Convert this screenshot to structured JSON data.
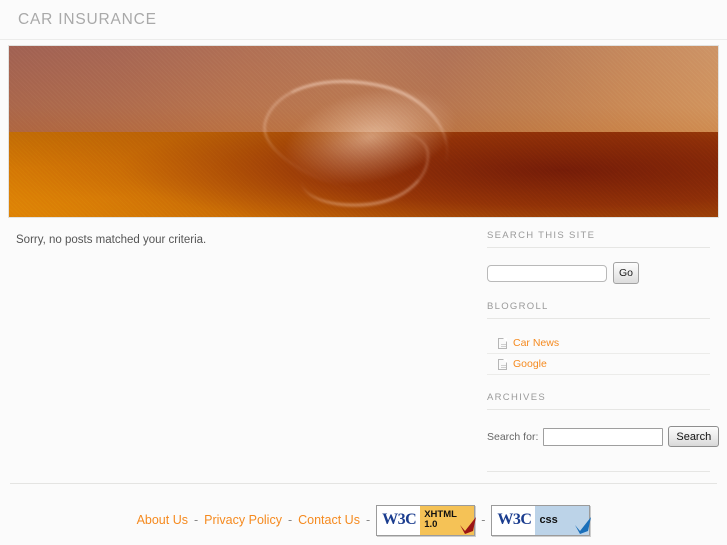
{
  "header": {
    "site_title": "CAR INSURANCE"
  },
  "banner": {
    "alt": "abstract orange gradient header image",
    "colors": {
      "top_left": "#a9695c",
      "top_right": "#e2aa77",
      "bottom_left": "#e58a06",
      "bottom_right": "#8d2c06",
      "swoosh": "#ffe4cd"
    }
  },
  "content": {
    "no_posts_message": "Sorry, no posts matched your criteria."
  },
  "sidebar": {
    "widgets": [
      {
        "id": "search-this-site",
        "title": "SEARCH THIS SITE",
        "input_value": "",
        "input_placeholder": "",
        "button_label": "Go"
      },
      {
        "id": "blogroll",
        "title": "BLOGROLL",
        "links": [
          {
            "label": "Car News",
            "icon": "document-icon"
          },
          {
            "label": "Google",
            "icon": "document-icon"
          }
        ]
      },
      {
        "id": "archives",
        "title": "ARCHIVES",
        "search_label": "Search for:",
        "search_value": "",
        "search_placeholder": "",
        "search_button_label": "Search"
      }
    ],
    "link_color": "#f58a1f"
  },
  "footer": {
    "links": [
      {
        "label": "About Us"
      },
      {
        "label": "Privacy Policy"
      },
      {
        "label": "Contact Us"
      }
    ],
    "separator": "-",
    "badges": [
      {
        "id": "xhtml",
        "w3c_label": "W3C",
        "line1": "XHTML",
        "line2": "1.0",
        "accent": "#f5c256",
        "check_color": "#9b1414"
      },
      {
        "id": "css",
        "w3c_label": "W3C",
        "line1": "css",
        "line2": "",
        "accent": "#bcd3e8",
        "check_color": "#1a6fba"
      }
    ]
  }
}
